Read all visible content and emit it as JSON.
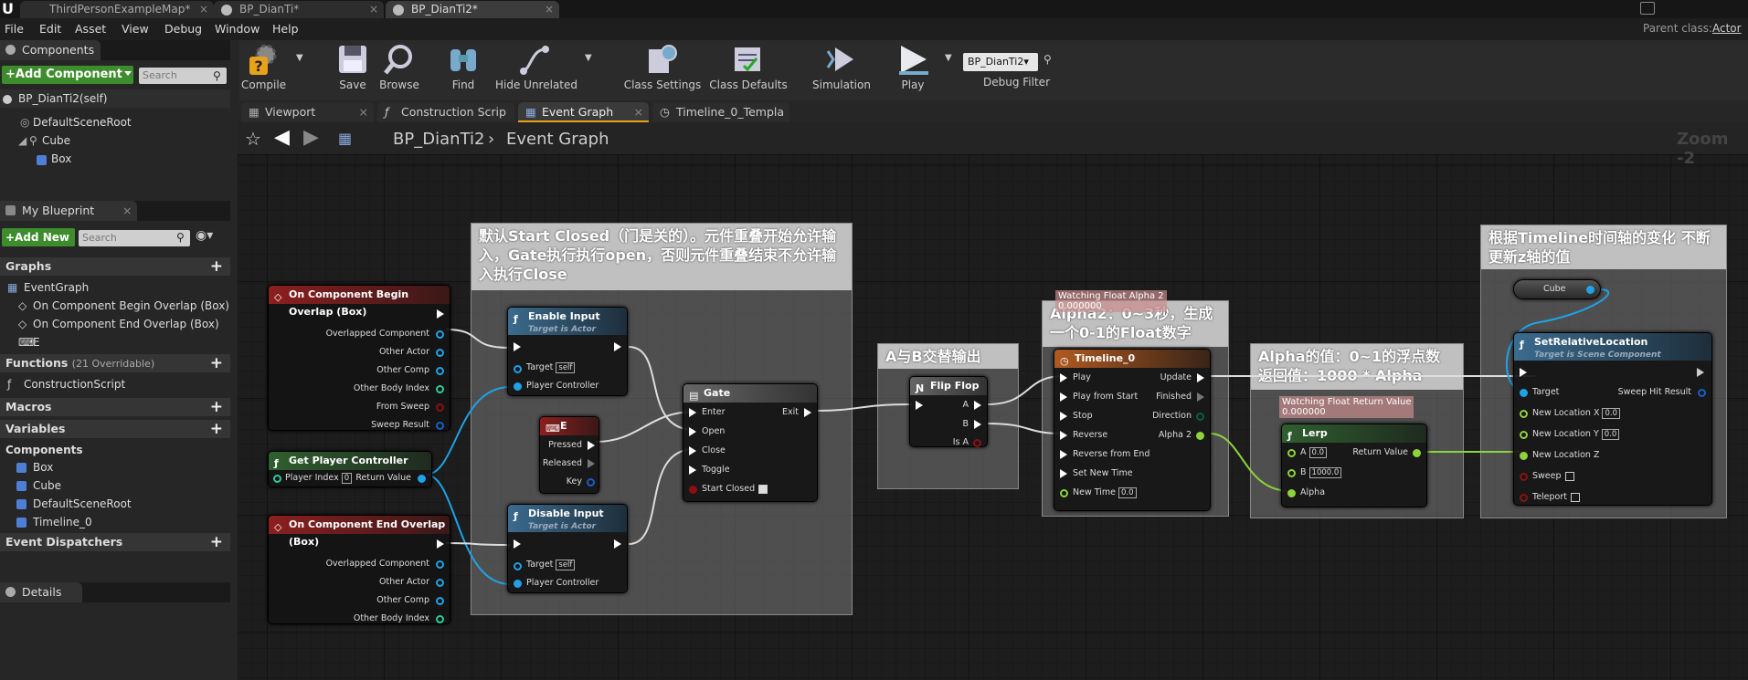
{
  "title_tabs": [
    "ThirdPersonExampleMap*",
    "BP_DianTi*",
    "BP_DianTi2*"
  ],
  "parent_class": {
    "label": "Parent class:",
    "value": "Actor"
  },
  "menu": [
    "File",
    "Edit",
    "Asset",
    "View",
    "Debug",
    "Window",
    "Help"
  ],
  "components_panel": {
    "title": "Components",
    "add_button": "+Add Component",
    "search_placeholder": "Search",
    "self_item": "BP_DianTi2(self)",
    "tree": [
      "DefaultSceneRoot",
      "Cube",
      "Box"
    ]
  },
  "my_blueprint": {
    "title": "My Blueprint",
    "add_button": "+Add New",
    "search_placeholder": "Search",
    "graphs_label": "Graphs",
    "event_graph": "EventGraph",
    "events": [
      "On Component Begin Overlap (Box)",
      "On Component End Overlap (Box)",
      "E"
    ],
    "functions_label": "Functions",
    "functions_count": "(21 Overridable)",
    "construction_script": "ConstructionScript",
    "macros_label": "Macros",
    "variables_label": "Variables",
    "components_label": "Components",
    "component_vars": [
      "Box",
      "Cube",
      "DefaultSceneRoot",
      "Timeline_0"
    ],
    "dispatchers_label": "Event Dispatchers"
  },
  "details_panel": {
    "title": "Details"
  },
  "toolbar": {
    "compile": "Compile",
    "save": "Save",
    "browse": "Browse",
    "find": "Find",
    "hide_unrelated": "Hide Unrelated",
    "class_settings": "Class Settings",
    "class_defaults": "Class Defaults",
    "simulation": "Simulation",
    "play": "Play",
    "debug_object": "BP_DianTi2▾",
    "debug_filter": "Debug Filter"
  },
  "editor_tabs": [
    "Viewport",
    "Construction Scrip",
    "Event Graph",
    "Timeline_0_Templa"
  ],
  "breadcrumb": {
    "blueprint": "BP_DianTi2",
    "graph": "Event Graph"
  },
  "zoom": "Zoom -2",
  "comments": {
    "gate": "默认Start Closed（门是关的）。元件重叠开始允许输入，Gate执行执行open，否则元件重叠结束不允许输入执行Close",
    "flipflop": "A与B交替输出",
    "timeline": "Alpha2：0~3秒，生成一个0-1的Float数字",
    "lerp": "Alpha的值：0~1的浮点数 返回值：1000 * Alpha",
    "location": "根据Timeline时间轴的变化 不断更新z轴的值"
  },
  "nodes": {
    "begin_overlap": {
      "title": "On Component Begin Overlap (Box)",
      "pins": [
        "Overlapped Component",
        "Other Actor",
        "Other Comp",
        "Other Body Index",
        "From Sweep",
        "Sweep Result"
      ]
    },
    "get_player_controller": {
      "title": "Get Player Controller",
      "player_index_label": "Player Index",
      "player_index": "0",
      "return_value": "Return Value"
    },
    "end_overlap": {
      "title": "On Component End Overlap (Box)",
      "pins": [
        "Overlapped Component",
        "Other Actor",
        "Other Comp",
        "Other Body Index"
      ]
    },
    "enable_input": {
      "title": "Enable Input",
      "subtitle": "Target is Actor",
      "target": "Target",
      "self": "self",
      "player_controller": "Player Controller"
    },
    "disable_input": {
      "title": "Disable Input",
      "subtitle": "Target is Actor",
      "target": "Target",
      "self": "self",
      "player_controller": "Player Controller"
    },
    "key_e": {
      "title": "E",
      "pins": [
        "Pressed",
        "Released",
        "Key"
      ]
    },
    "gate": {
      "title": "Gate",
      "inputs": [
        "Enter",
        "Open",
        "Close",
        "Toggle",
        "Start Closed"
      ],
      "exit": "Exit"
    },
    "flipflop": {
      "title": "Flip Flop",
      "a": "A",
      "b": "B",
      "is_a": "Is A"
    },
    "timeline": {
      "title": "Timeline_0",
      "watch": "Watching Float Alpha 2",
      "watch_value": "0.000000",
      "inputs": [
        "Play",
        "Play from Start",
        "Stop",
        "Reverse",
        "Reverse from End",
        "Set New Time",
        "New Time"
      ],
      "new_time": "0.0",
      "outputs": [
        "Update",
        "Finished",
        "Direction",
        "Alpha 2"
      ]
    },
    "lerp": {
      "title": "Lerp",
      "watch": "Watching Float Return Value",
      "watch_value": "0.000000",
      "a": "A",
      "a_val": "0.0",
      "b": "B",
      "b_val": "1000.0",
      "alpha": "Alpha",
      "return_value": "Return Value"
    },
    "cube": {
      "title": "Cube"
    },
    "set_location": {
      "title": "SetRelativeLocation",
      "subtitle": "Target is Scene Component",
      "target": "Target",
      "sweep_hit": "Sweep Hit Result",
      "x_label": "New Location X",
      "x": "0.0",
      "y_label": "New Location Y",
      "y": "0.0",
      "z_label": "New Location Z",
      "sweep": "Sweep",
      "teleport": "Teleport"
    }
  }
}
